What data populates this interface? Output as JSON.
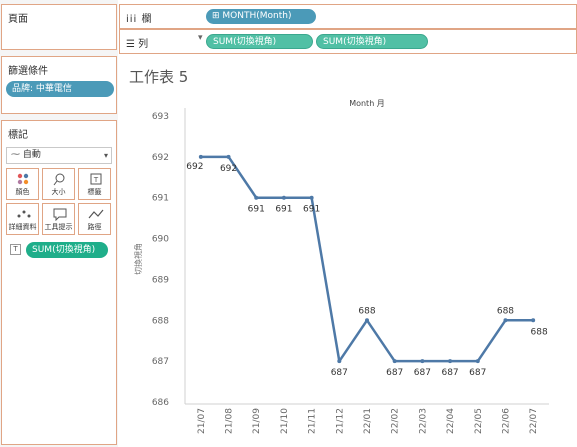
{
  "panels": {
    "pages": {
      "title": "頁面"
    },
    "filters": {
      "title": "篩選條件",
      "pill": "品牌: 中華電信"
    },
    "marks": {
      "title": "標記",
      "type_value": "自動",
      "buttons": [
        {
          "label": "顏色",
          "icon": "color-dots-icon"
        },
        {
          "label": "大小",
          "icon": "size-icon"
        },
        {
          "label": "標籤",
          "icon": "label-icon"
        },
        {
          "label": "詳細資料",
          "icon": "detail-icon"
        },
        {
          "label": "工具提示",
          "icon": "tooltip-icon"
        },
        {
          "label": "路徑",
          "icon": "path-icon"
        }
      ],
      "field_pill": "SUM(切換視角)",
      "field_icon": "T"
    }
  },
  "shelves": {
    "columns": {
      "label": "欄",
      "pill": "MONTH(Month)"
    },
    "rows": {
      "label": "列",
      "pills": [
        "SUM(切換視角)",
        "SUM(切換視角)"
      ]
    }
  },
  "sheet": {
    "title": "工作表 5"
  },
  "chart_data": {
    "type": "line",
    "title": "Month 月",
    "xlabel": "",
    "ylabel": "切換視角",
    "categories": [
      "21/07",
      "21/08",
      "21/09",
      "21/10",
      "21/11",
      "21/12",
      "22/01",
      "22/02",
      "22/03",
      "22/04",
      "22/05",
      "22/06",
      "22/07"
    ],
    "values": [
      692,
      692,
      691,
      691,
      691,
      687,
      688,
      687,
      687,
      687,
      687,
      688,
      688
    ],
    "ylim": [
      686,
      693
    ],
    "yticks": [
      686,
      687,
      688,
      689,
      690,
      691,
      692,
      693
    ],
    "line_color": "#4e79a7",
    "grid": false
  }
}
